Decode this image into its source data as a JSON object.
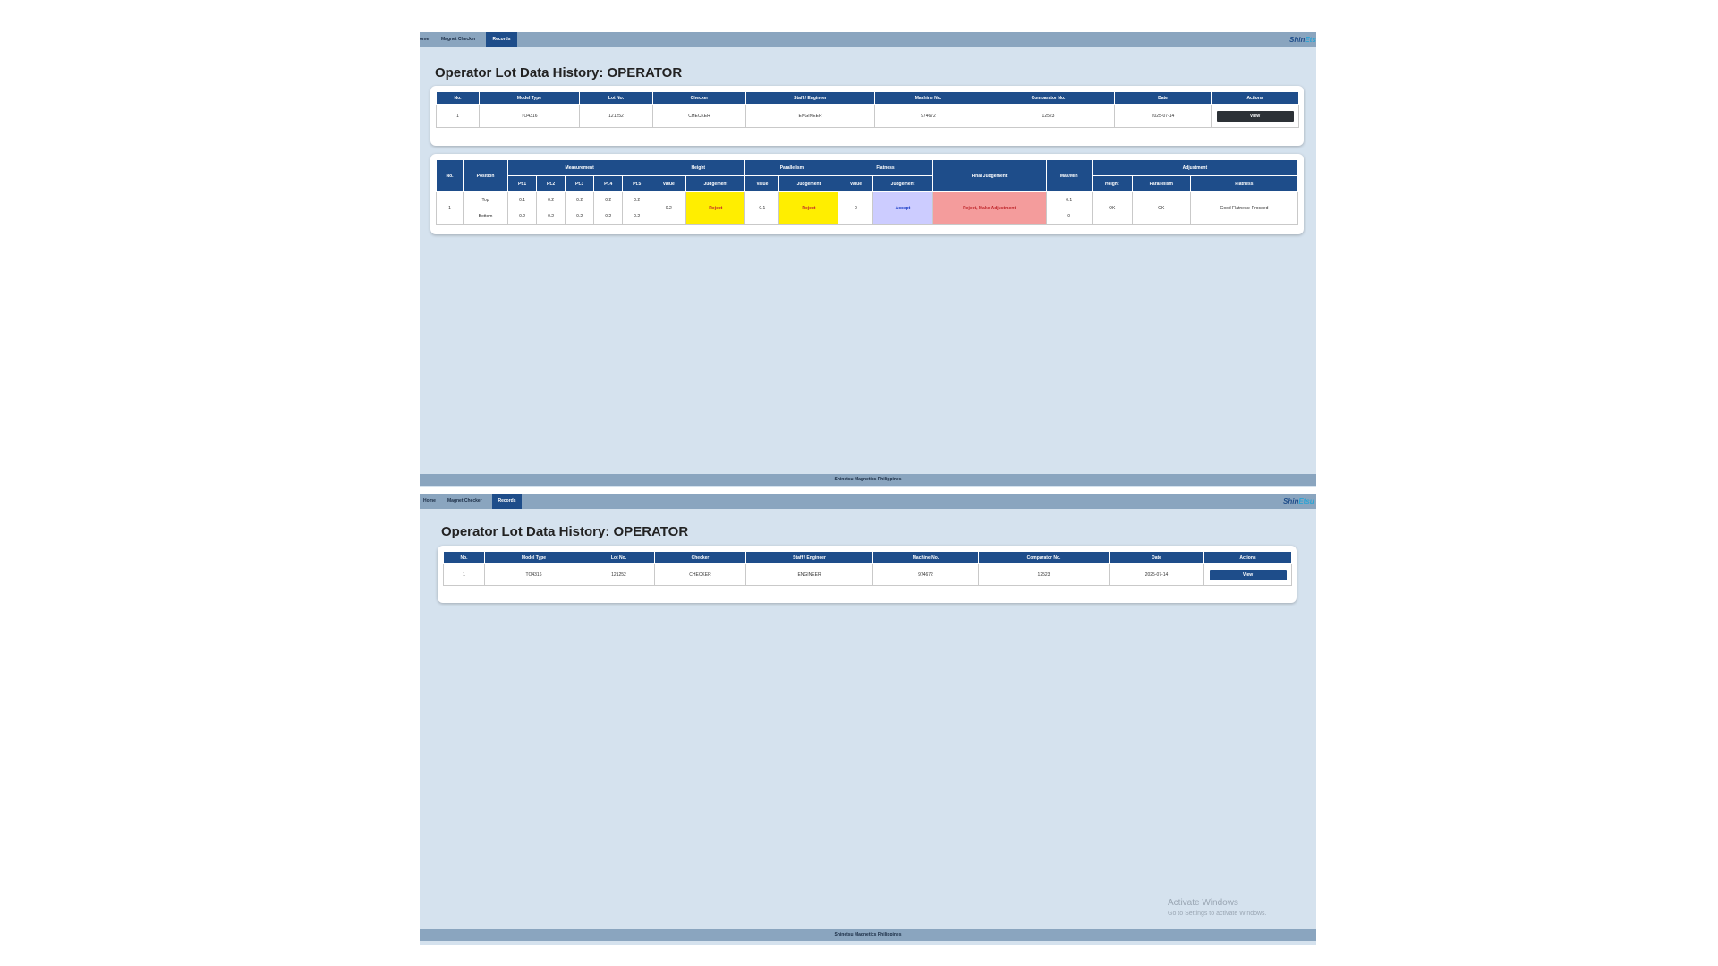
{
  "nav": {
    "items": [
      "Home",
      "Magnet Checker",
      "Records"
    ],
    "items_first_panel": [
      "ome",
      "Magnet Checker",
      "Records"
    ],
    "active": "Records",
    "brand_part1": "Shin",
    "brand_part2": "Etsu"
  },
  "page": {
    "title": "Operator Lot Data History: OPERATOR"
  },
  "lot_table": {
    "headers": [
      "No.",
      "Model Type",
      "Lot No.",
      "Checker",
      "Staff / Engineer",
      "Machine No.",
      "Comparator No.",
      "Date",
      "Actions"
    ],
    "rows": [
      {
        "no": "1",
        "model_type": "TO4316",
        "lot_no": "121252",
        "checker": "CHECKER",
        "staff_engineer": "ENGINEER",
        "machine_no": "974672",
        "comparator_no": "12523",
        "date": "2025-07-14",
        "action_label": "View"
      }
    ]
  },
  "detail_table": {
    "headers_top": {
      "no": "No.",
      "position": "Position",
      "measurement": "Measurement",
      "height": "Height",
      "parallelism": "Parallelism",
      "flatness": "Flatness",
      "final_judgement": "Final Judgement",
      "max_min": "Max/Min",
      "adjustment": "Adjustment"
    },
    "headers_sub": {
      "pt": [
        "Pt.1",
        "Pt.2",
        "Pt.3",
        "Pt.4",
        "Pt.5"
      ],
      "value": "Value",
      "judgement": "Judgement",
      "adj_height": "Height",
      "adj_parallelism": "Parallelism",
      "adj_flatness": "Flatness"
    },
    "row": {
      "no": "1",
      "top": {
        "position": "Top",
        "pts": [
          "0.1",
          "0.2",
          "0.2",
          "0.2",
          "0.2"
        ],
        "max_min": "0.1"
      },
      "bottom": {
        "position": "Bottom",
        "pts": [
          "0.2",
          "0.2",
          "0.2",
          "0.2",
          "0.2"
        ],
        "max_min": "0"
      },
      "height_value": "0.2",
      "height_judgement": "Reject",
      "parallelism_value": "0.1",
      "parallelism_judgement": "Reject",
      "flatness_value": "0",
      "flatness_judgement": "Accept",
      "final_judgement": "Reject, Make Adjustment",
      "adj_height": "OK",
      "adj_parallelism": "OK",
      "adj_flatness": "Good Flatness: Proceed"
    }
  },
  "footer": {
    "text": "Shinetsu Magnetics Philippines"
  },
  "watermark": {
    "line1": "Activate Windows",
    "line2": "Go to Settings to activate Windows."
  },
  "colors": {
    "page_bg": "#d5e2ee",
    "nav_bg": "#8aa5bf",
    "header_bg": "#1e4d8a",
    "reject_bg": "#ffee00",
    "accept_bg": "#ccccff",
    "final_reject_bg": "#f49c9c"
  }
}
